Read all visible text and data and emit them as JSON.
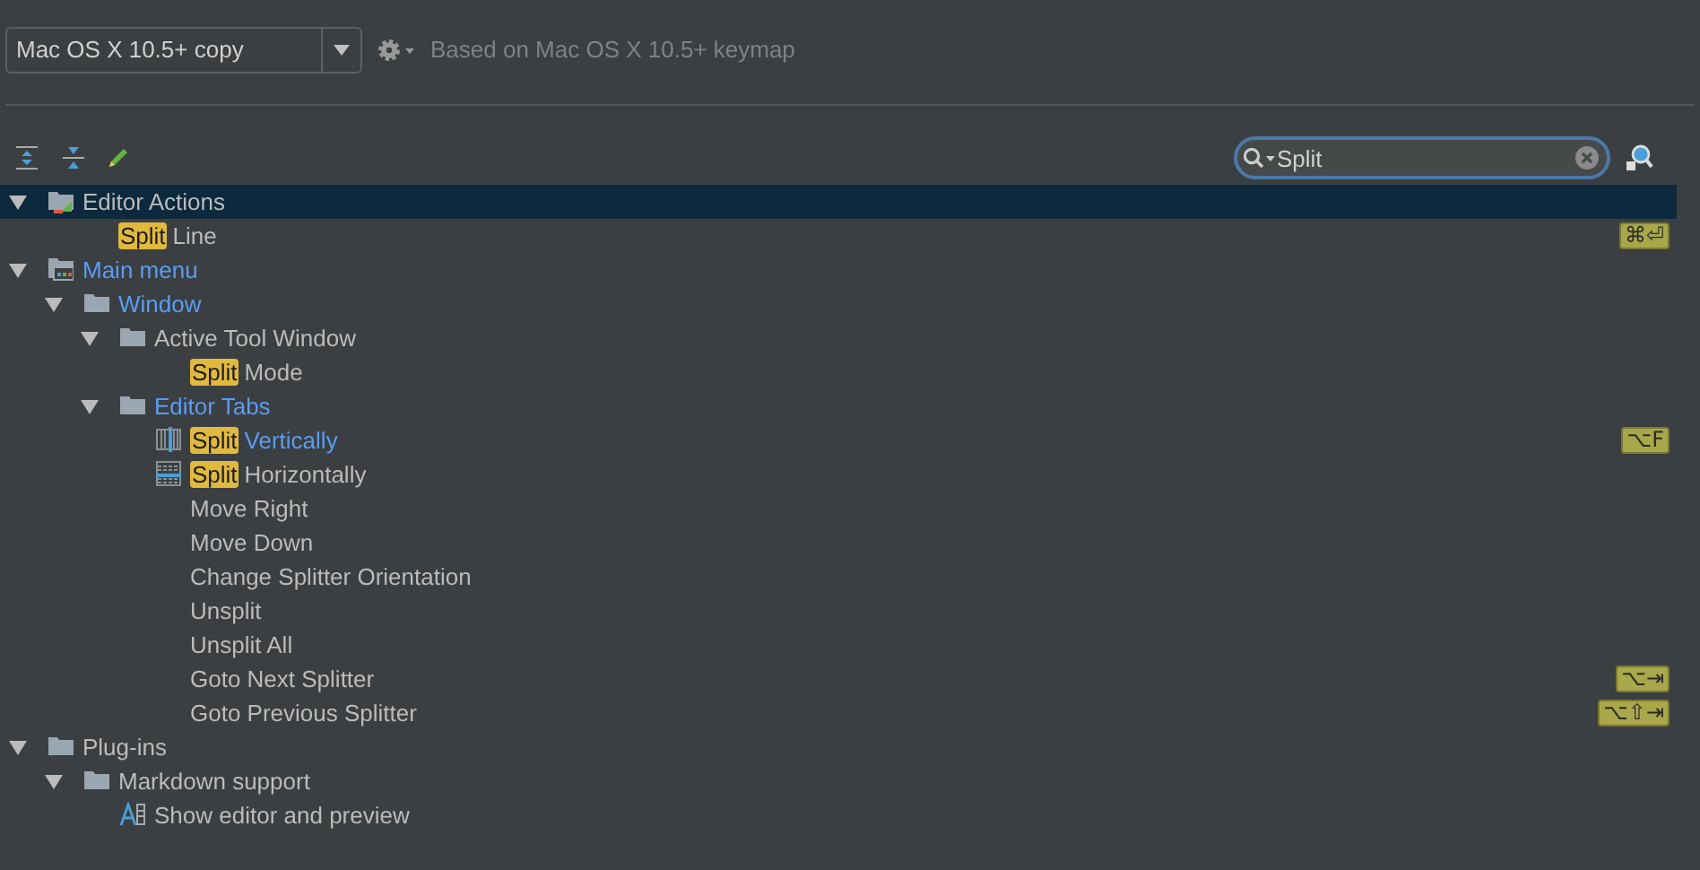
{
  "keymap_select": {
    "value": "Mac OS X 10.5+ copy"
  },
  "based_on": "Based on Mac OS X 10.5+ keymap",
  "search": {
    "value": "Split"
  },
  "tree": [
    {
      "label": "Editor Actions",
      "kind": "actions",
      "expanded": true,
      "selected": true,
      "modified": false,
      "children": [
        {
          "match": "Split",
          "label": "Line",
          "modified": false,
          "selected": false,
          "shortcut": "⌘⏎"
        }
      ]
    },
    {
      "label": "Main menu",
      "kind": "menu",
      "expanded": true,
      "selected": false,
      "modified": true,
      "children": [
        {
          "label": "Window",
          "kind": "folder",
          "expanded": true,
          "selected": false,
          "modified": true,
          "children": [
            {
              "label": "Active Tool Window",
              "kind": "folder",
              "expanded": true,
              "selected": false,
              "modified": false,
              "children": [
                {
                  "match": "Split",
                  "label": "Mode",
                  "modified": false,
                  "selected": false
                }
              ]
            },
            {
              "label": "Editor Tabs",
              "kind": "folder",
              "expanded": true,
              "selected": false,
              "modified": true,
              "children": [
                {
                  "match": "Split",
                  "label": "Vertically",
                  "kind": "split-vertical",
                  "modified": true,
                  "selected": false,
                  "shortcut": "⌥F"
                },
                {
                  "match": "Split",
                  "label": "Horizontally",
                  "kind": "split-horizontal",
                  "modified": false,
                  "selected": false
                },
                {
                  "label": "Move Right",
                  "modified": false,
                  "selected": false
                },
                {
                  "label": "Move Down",
                  "modified": false,
                  "selected": false
                },
                {
                  "label": "Change Splitter Orientation",
                  "modified": false,
                  "selected": false
                },
                {
                  "label": "Unsplit",
                  "modified": false,
                  "selected": false
                },
                {
                  "label": "Unsplit All",
                  "modified": false,
                  "selected": false
                },
                {
                  "label": "Goto Next Splitter",
                  "modified": false,
                  "selected": false,
                  "shortcut": "⌥⇥"
                },
                {
                  "label": "Goto Previous Splitter",
                  "modified": false,
                  "selected": false,
                  "shortcut": "⌥⇧⇥"
                }
              ]
            }
          ]
        }
      ]
    },
    {
      "label": "Plug-ins",
      "kind": "folder",
      "expanded": true,
      "selected": false,
      "modified": false,
      "children": [
        {
          "label": "Markdown support",
          "kind": "folder",
          "expanded": true,
          "selected": false,
          "modified": false,
          "children": [
            {
              "label": "Show editor and preview",
              "kind": "markdown",
              "modified": false,
              "selected": false
            }
          ]
        }
      ]
    }
  ]
}
